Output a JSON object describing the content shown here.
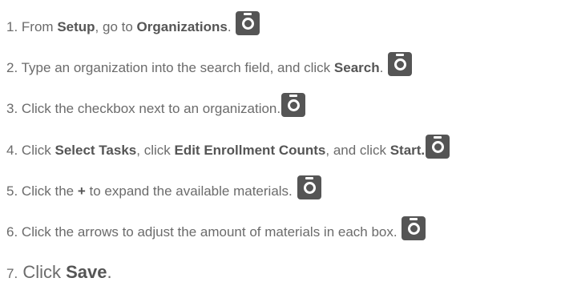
{
  "steps": [
    {
      "number": "1.",
      "parts": [
        "From ",
        "Setup",
        ", go to ",
        "Organizations",
        "."
      ]
    },
    {
      "number": "2.",
      "parts": [
        "Type an organization into the search field, and click ",
        "Search",
        "."
      ]
    },
    {
      "number": "3.",
      "parts": [
        "Click the checkbox next to an organization."
      ]
    },
    {
      "number": "4.",
      "parts": [
        "Click ",
        "Select Tasks",
        ", click ",
        "Edit Enrollment Counts",
        ", and click ",
        "Start."
      ]
    },
    {
      "number": "5.",
      "parts": [
        "Click the ",
        "+",
        " to expand the available materials."
      ]
    },
    {
      "number": "6.",
      "parts": [
        "Click the arrows to adjust the amount of materials in each box."
      ]
    },
    {
      "number": "7.",
      "parts": [
        "Click ",
        "Save",
        "."
      ]
    }
  ],
  "icons": {
    "screenshot": "camera-icon"
  },
  "colors": {
    "text": "#6b6b6b",
    "bold_text": "#555555",
    "icon_background": "#555555",
    "background": "#ffffff"
  }
}
